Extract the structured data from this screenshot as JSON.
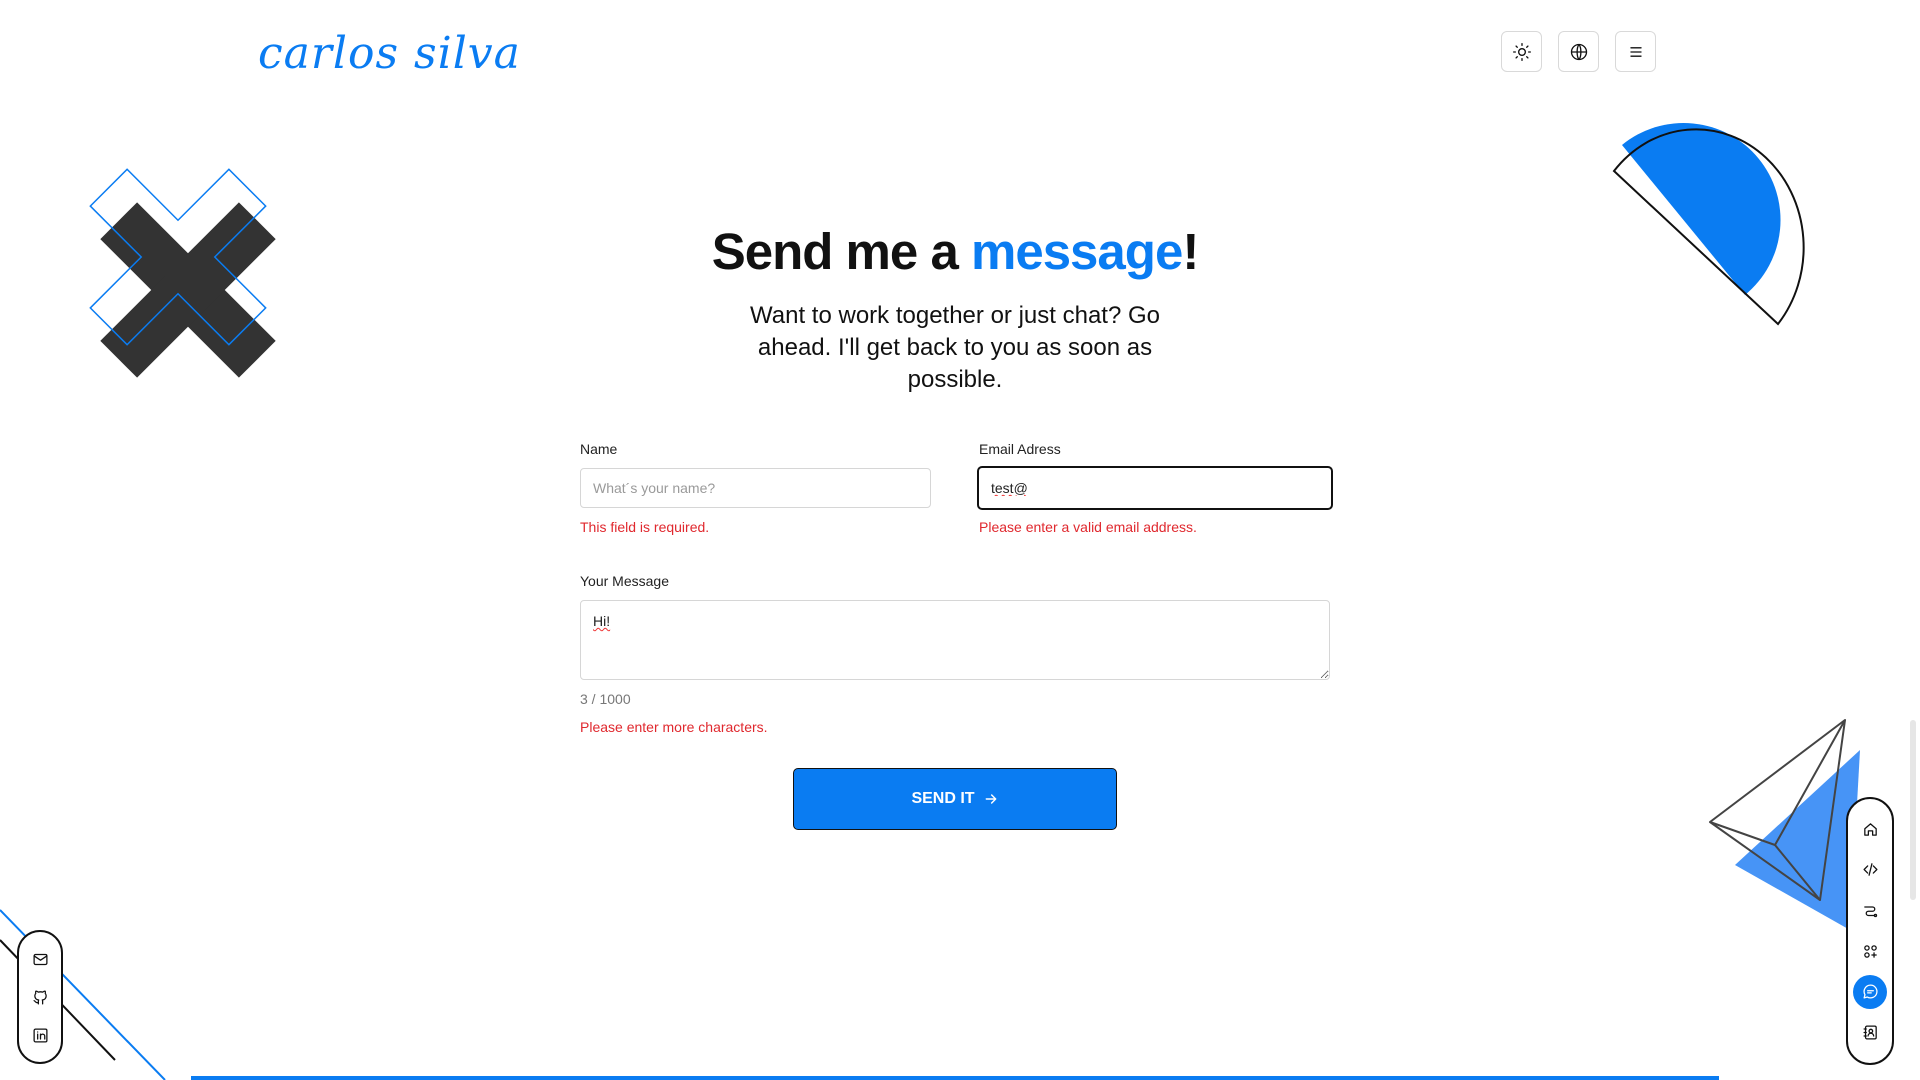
{
  "header": {
    "logo": "carlos silva",
    "icons": [
      "sun-icon",
      "globe-icon",
      "menu-icon"
    ]
  },
  "hero": {
    "title_pre": "Send me a ",
    "title_accent": "message",
    "title_post": "!",
    "subtitle": "Want to work together or just chat? Go ahead. I'll get back to you as soon as possible."
  },
  "form": {
    "name_label": "Name",
    "name_placeholder": "What´s your name?",
    "name_value": "",
    "name_error": "This field is required.",
    "email_label": "Email Adress",
    "email_value": "test@",
    "email_error": "Please enter a valid email address.",
    "message_label": "Your Message",
    "message_value": "Hi!",
    "message_counter": "3 / 1000",
    "message_error": "Please enter more characters.",
    "submit_label": "SEND IT"
  },
  "social_nav": [
    "mail-icon",
    "github-icon",
    "linkedin-icon"
  ],
  "section_nav": {
    "items": [
      "home-icon",
      "code-icon",
      "route-icon",
      "apps-icon",
      "chat-icon",
      "contact-book-icon"
    ],
    "active": "chat-icon"
  },
  "colors": {
    "accent": "#0a7cf2",
    "error": "#e0282e",
    "text": "#111111",
    "decor_dark": "#333333"
  }
}
